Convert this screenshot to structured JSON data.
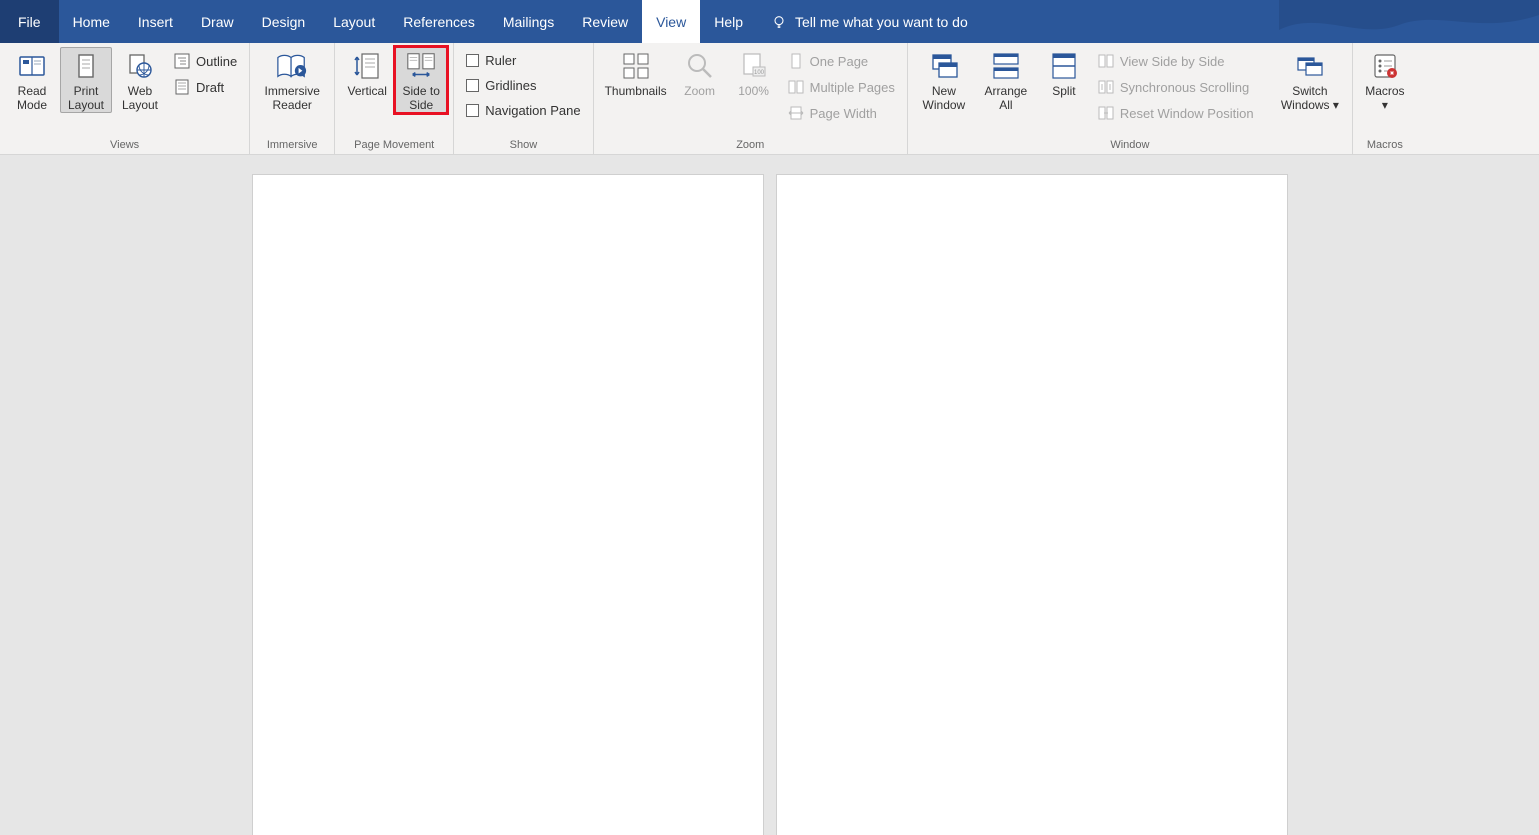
{
  "menu": {
    "file": "File",
    "tabs": [
      "Home",
      "Insert",
      "Draw",
      "Design",
      "Layout",
      "References",
      "Mailings",
      "Review",
      "View",
      "Help"
    ],
    "activeTab": "View",
    "tellme": "Tell me what you want to do"
  },
  "ribbon": {
    "views": {
      "label": "Views",
      "readMode": "Read Mode",
      "printLayout": "Print Layout",
      "webLayout": "Web Layout",
      "outline": "Outline",
      "draft": "Draft"
    },
    "immersive": {
      "label": "Immersive",
      "reader": "Immersive Reader"
    },
    "pageMovement": {
      "label": "Page Movement",
      "vertical": "Vertical",
      "sideToSide": "Side to Side"
    },
    "show": {
      "label": "Show",
      "ruler": "Ruler",
      "gridlines": "Gridlines",
      "navigation": "Navigation Pane"
    },
    "zoom": {
      "label": "Zoom",
      "thumbnails": "Thumbnails",
      "zoom": "Zoom",
      "hundred": "100%",
      "onePage": "One Page",
      "multiplePages": "Multiple Pages",
      "pageWidth": "Page Width"
    },
    "window": {
      "label": "Window",
      "newWindow": "New Window",
      "arrangeAll": "Arrange All",
      "split": "Split",
      "viewSide": "View Side by Side",
      "syncScroll": "Synchronous Scrolling",
      "resetPos": "Reset Window Position",
      "switch": "Switch Windows"
    },
    "macros": {
      "label": "Macros",
      "macros": "Macros"
    }
  }
}
